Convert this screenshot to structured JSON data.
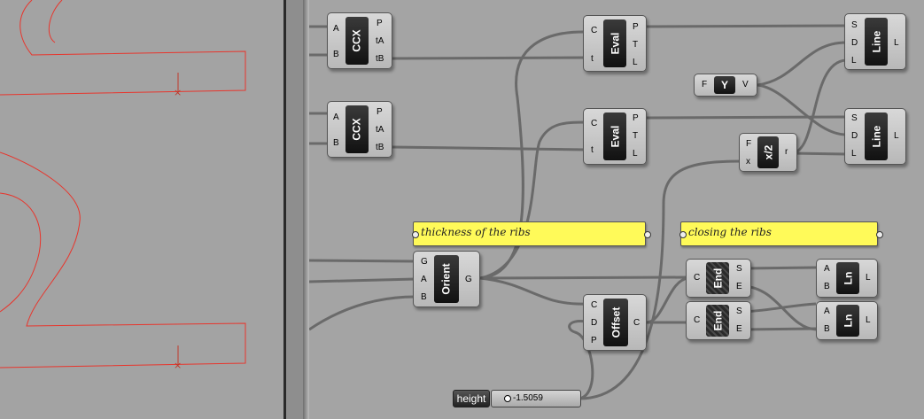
{
  "panels": {
    "thickness": "thickness of the ribs",
    "closing": "closing the ribs"
  },
  "slider": {
    "name": "height",
    "value": "-1.5059"
  },
  "components": {
    "ccx1": {
      "label": "CCX",
      "inputs": [
        "A",
        "B"
      ],
      "outputs": [
        "P",
        "tA",
        "tB"
      ]
    },
    "ccx2": {
      "label": "CCX",
      "inputs": [
        "A",
        "B"
      ],
      "outputs": [
        "P",
        "tA",
        "tB"
      ]
    },
    "eval1": {
      "label": "Eval",
      "inputs": [
        "C",
        "t"
      ],
      "outputs": [
        "P",
        "T",
        "L"
      ]
    },
    "eval2": {
      "label": "Eval",
      "inputs": [
        "C",
        "t"
      ],
      "outputs": [
        "P",
        "T",
        "L"
      ]
    },
    "line1": {
      "label": "Line",
      "inputs": [
        "S",
        "D",
        "L"
      ],
      "outputs": [
        "L"
      ]
    },
    "line2": {
      "label": "Line",
      "inputs": [
        "S",
        "D",
        "L"
      ],
      "outputs": [
        "L"
      ]
    },
    "y": {
      "label": "Y",
      "inputs": [
        "F"
      ],
      "outputs": [
        "V"
      ]
    },
    "half": {
      "label": "x/2",
      "inputs": [
        "F",
        "x"
      ],
      "outputs": [
        "r"
      ]
    },
    "orient": {
      "label": "Orient",
      "inputs": [
        "G",
        "A",
        "B"
      ],
      "outputs": [
        "G"
      ]
    },
    "offset": {
      "label": "Offset",
      "inputs": [
        "C",
        "D",
        "P"
      ],
      "outputs": [
        "C"
      ]
    },
    "end1": {
      "label": "End",
      "inputs": [
        "C"
      ],
      "outputs": [
        "S",
        "E"
      ]
    },
    "end2": {
      "label": "End",
      "inputs": [
        "C"
      ],
      "outputs": [
        "S",
        "E"
      ]
    },
    "ln1": {
      "label": "Ln",
      "inputs": [
        "A",
        "B"
      ],
      "outputs": [
        "L"
      ]
    },
    "ln2": {
      "label": "Ln",
      "inputs": [
        "A",
        "B"
      ],
      "outputs": [
        "L"
      ]
    }
  },
  "colors": {
    "curve": "#e8352c",
    "wire": "#6a6a6a",
    "panel": "#fffa59"
  }
}
